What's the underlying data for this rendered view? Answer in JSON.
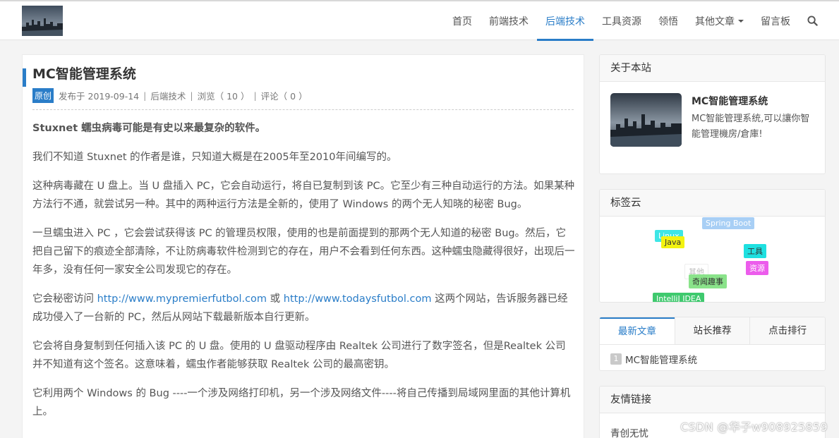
{
  "nav": {
    "items": [
      {
        "label": "首页"
      },
      {
        "label": "前端技术"
      },
      {
        "label": "后端技术"
      },
      {
        "label": "工具资源"
      },
      {
        "label": "领悟"
      },
      {
        "label": "其他文章"
      },
      {
        "label": "留言板"
      }
    ],
    "active_index": 2,
    "search_icon": "search-icon",
    "accent_color": "#2a7dc8"
  },
  "article": {
    "title": "MC智能管理系统",
    "badge": "原创",
    "published": "发布于 2019-09-14",
    "category": "后端技术",
    "views": "浏览（ 10 ）",
    "comments": "评论（ 0 ）",
    "paragraphs": {
      "p0": "Stuxnet 蠕虫病毒可能是有史以来最复杂的软件。",
      "p1": "我们不知道 Stuxnet 的作者是谁，只知道大概是在2005年至2010年间编写的。",
      "p2": "这种病毒藏在 U 盘上。当 U 盘插入 PC，它会自动运行，将自已复制到该 PC。它至少有三种自动运行的方法。如果某种方法行不通，就尝试另一种。其中的两种运行方法是全新的，使用了 Windows 的两个无人知晓的秘密 Bug。",
      "p3": "一旦蠕虫进入 PC ，它会尝试获得该 PC 的管理员权限，使用的也是前面提到的那两个无人知道的秘密 Bug。然后，它把自己留下的痕迹全部清除，不让防病毒软件检测到它的存在，用户不会看到任何东西。这种蠕虫隐藏得很好，出现后一年多，没有任何一家安全公司发现它的存在。",
      "p4_before": "它会秘密访问 ",
      "p4_link1": "http://www.mypremierfutbol.com",
      "p4_mid": " 或 ",
      "p4_link2": "http://www.todaysfutbol.com",
      "p4_after": " 这两个网站，告诉服务器已经成功侵入了一台新的 PC，然后从网站下载最新版本自行更新。",
      "p5": "它会将自身复制到任何插入该 PC 的 U 盘。使用的 U 盘驱动程序由 Realtek 公司进行了数字签名，但是Realtek 公司并不知道有这个签名。这意味着，蠕虫作者能够获取 Realtek 公司的最高密钥。",
      "p6": "它利用两个 Windows 的 Bug ----一个涉及网络打印机，另一个涉及网络文件----将自己传播到局域网里面的其他计算机上。"
    }
  },
  "sidebar": {
    "about": {
      "heading": "关于本站",
      "name": "MC智能管理系统",
      "desc": "MC智能管理系统,可以讓你智能管理機房/倉庫!"
    },
    "tags": {
      "heading": "标签云",
      "items": {
        "t0": {
          "label": "Spring Boot",
          "bg": "#a8cff5",
          "fg": "#fff"
        },
        "t1": {
          "label": "Linux",
          "bg": "#3ee6e6",
          "fg": "#fff"
        },
        "t2": {
          "label": "Java",
          "bg": "#f3f311",
          "fg": "#333"
        },
        "t3": {
          "label": "工具",
          "bg": "#1ee0e0",
          "fg": "#333"
        },
        "t4": {
          "label": "其他",
          "bg": "#ffffff",
          "fg": "#bbb"
        },
        "t5": {
          "label": "资源",
          "bg": "#ec5cec",
          "fg": "#fff"
        },
        "t6": {
          "label": "奇闻趣事",
          "bg": "#8ae38a",
          "fg": "#333"
        },
        "t7": {
          "label": "IntelliJ IDEA",
          "bg": "#3fc96e",
          "fg": "#fff"
        }
      }
    },
    "tabs": {
      "items": [
        {
          "label": "最新文章"
        },
        {
          "label": "站长推荐"
        },
        {
          "label": "点击排行"
        }
      ],
      "active_index": 0,
      "recent": [
        {
          "rank": "1",
          "title": "MC智能管理系统"
        }
      ]
    },
    "links": {
      "heading": "友情链接",
      "items": [
        {
          "label": "青创无忧"
        }
      ]
    }
  },
  "watermark": "CSDN @华子w908925859"
}
